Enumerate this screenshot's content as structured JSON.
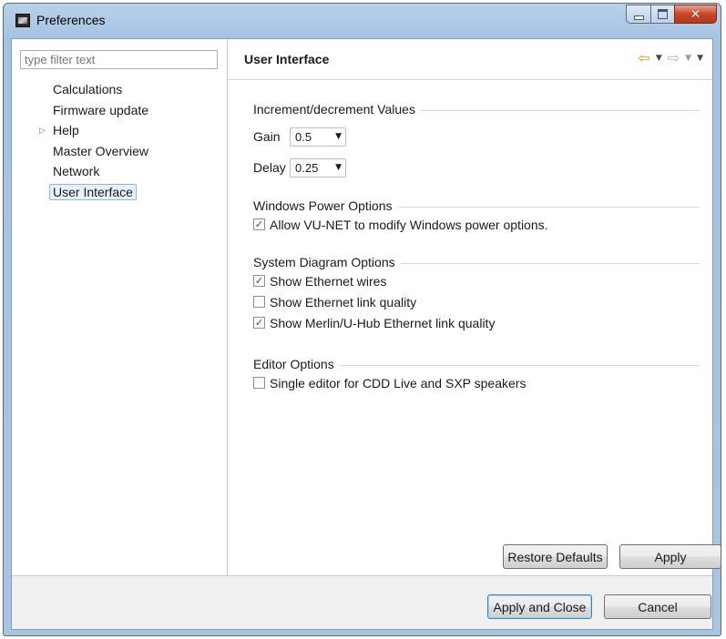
{
  "window": {
    "title": "Preferences",
    "icons": {
      "app": "app-logo-icon",
      "minimize": "minimize-icon",
      "maximize": "maximize-icon",
      "close": "close-icon"
    }
  },
  "sidebar": {
    "filter_placeholder": "type filter text",
    "items": [
      {
        "label": "Calculations"
      },
      {
        "label": "Firmware update"
      },
      {
        "label": "Help",
        "expandable": true
      },
      {
        "label": "Master Overview"
      },
      {
        "label": "Network"
      },
      {
        "label": "User Interface",
        "selected": true
      }
    ]
  },
  "main": {
    "title": "User Interface",
    "nav_icons": [
      "back-arrow-icon",
      "dropdown-icon",
      "forward-arrow-icon",
      "dropdown-icon",
      "view-menu-icon"
    ],
    "increment": {
      "title": "Increment/decrement Values",
      "gain_label": "Gain",
      "gain_value": "0.5",
      "delay_label": "Delay",
      "delay_value": "0.25"
    },
    "power": {
      "title": "Windows Power Options",
      "allow_label": "Allow VU-NET to modify Windows power options.",
      "allow_checked": true
    },
    "diagram": {
      "title": "System Diagram Options",
      "ethernet_wires_label": "Show Ethernet wires",
      "ethernet_wires_checked": true,
      "link_quality_label": "Show Ethernet link quality",
      "link_quality_checked": false,
      "merlin_label": "Show Merlin/U-Hub Ethernet link quality",
      "merlin_checked": true
    },
    "editor": {
      "title": "Editor Options",
      "single_editor_label": "Single editor for CDD Live and SXP speakers",
      "single_editor_checked": false
    },
    "restore_defaults": "Restore Defaults",
    "apply": "Apply"
  },
  "footer": {
    "apply_close": "Apply and Close",
    "cancel": "Cancel"
  },
  "colors": {
    "title_bar": "#b4cde9",
    "close_button": "#c7472a",
    "back_arrow": "#d9a200",
    "default_button_border": "#3c7fb1"
  }
}
